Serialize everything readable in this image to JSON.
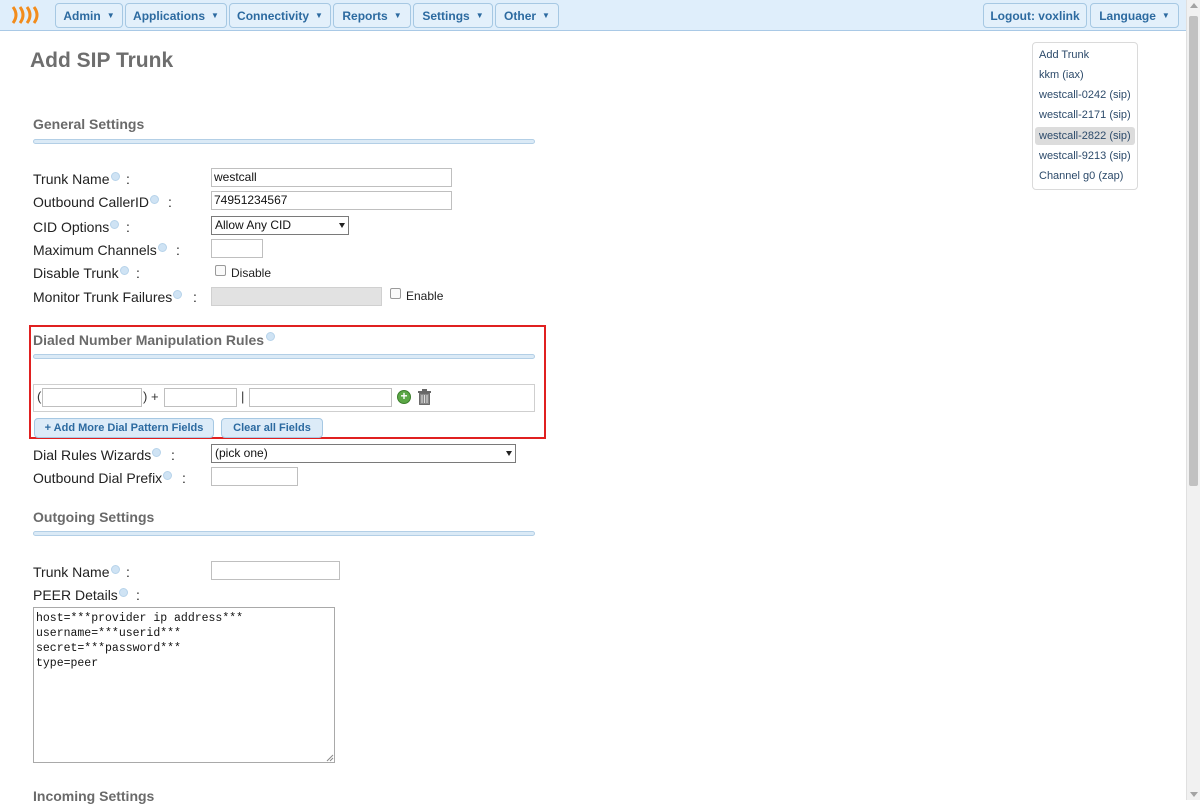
{
  "nav": {
    "admin": "Admin",
    "applications": "Applications",
    "connectivity": "Connectivity",
    "reports": "Reports",
    "settings": "Settings",
    "other": "Other",
    "logout": "Logout: voxlink",
    "language": "Language"
  },
  "page_title": "Add SIP Trunk",
  "general": {
    "title": "General Settings",
    "trunk_name_label": "Trunk Name",
    "trunk_name_value": "westcall",
    "outbound_cid_label": "Outbound CallerID",
    "outbound_cid_value": "74951234567",
    "cid_options_label": "CID Options",
    "cid_options_value": "Allow Any CID",
    "max_channels_label": "Maximum Channels",
    "max_channels_value": "",
    "disable_trunk_label": "Disable Trunk",
    "disable_cb_label": "Disable",
    "monitor_label": "Monitor Trunk Failures",
    "monitor_value": "",
    "enable_cb_label": "Enable",
    "colon": ":"
  },
  "dial_rules": {
    "title": "Dialed Number Manipulation Rules",
    "open_paren": "(",
    "close_plus": ") +",
    "pipe": "|",
    "prepend_value": "",
    "prefix_value": "",
    "pattern_value": "",
    "add_more_label": "+ Add More Dial Pattern Fields",
    "clear_all_label": "Clear all Fields",
    "wizards_label": "Dial Rules Wizards",
    "wizards_value": "(pick one)",
    "outbound_prefix_label": "Outbound Dial Prefix",
    "outbound_prefix_value": ""
  },
  "outgoing": {
    "title": "Outgoing Settings",
    "trunk_name_label": "Trunk Name",
    "trunk_name_value": "",
    "peer_label": "PEER Details",
    "peer_value": "host=***provider ip address***\nusername=***userid***\nsecret=***password***\ntype=peer"
  },
  "incoming": {
    "title": "Incoming Settings"
  },
  "trunks": [
    {
      "label": "Add Trunk"
    },
    {
      "label": "kkm (iax)"
    },
    {
      "label": "westcall-0242 (sip)"
    },
    {
      "label": "westcall-2171 (sip)"
    },
    {
      "label": "westcall-2822 (sip)",
      "active": true
    },
    {
      "label": "westcall-9213 (sip)"
    },
    {
      "label": "Channel g0 (zap)"
    }
  ],
  "colors": {
    "nav_text": "#2c6aa0",
    "highlight_border": "#e02020",
    "logo": "#f28c1c"
  }
}
